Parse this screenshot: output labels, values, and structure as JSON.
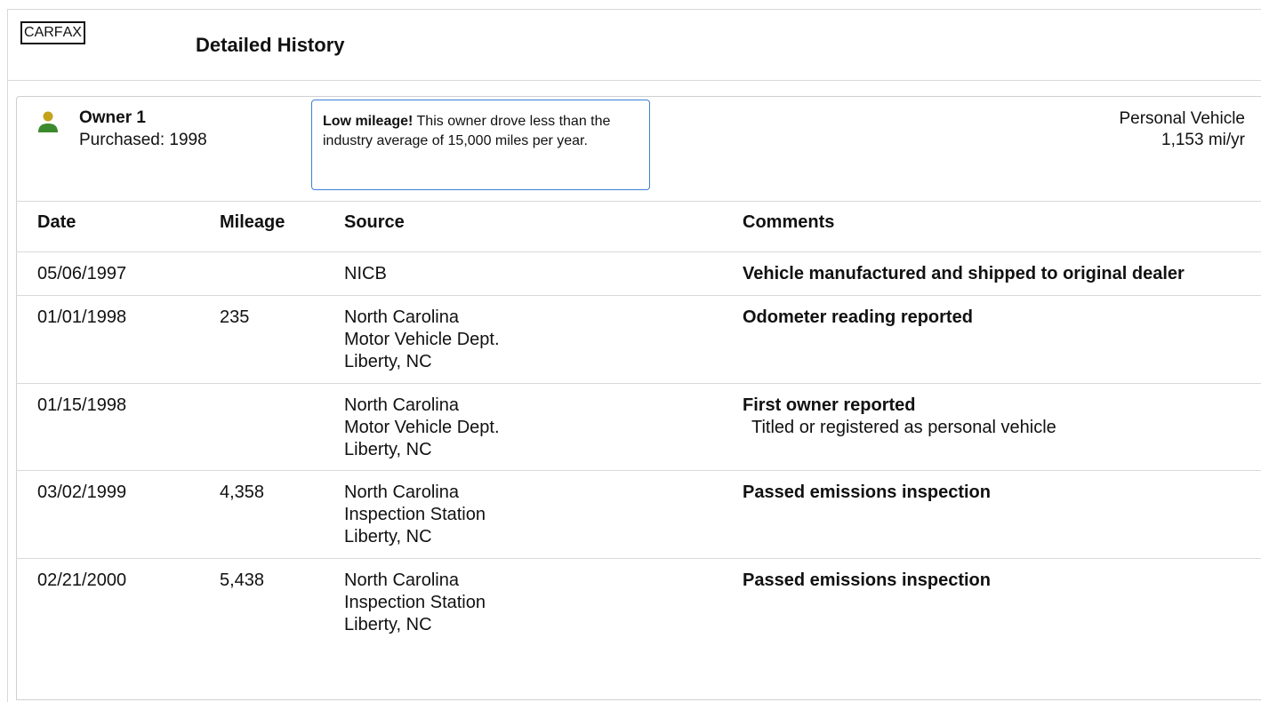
{
  "header": {
    "logo_letters": [
      "C",
      "A",
      "R",
      "F",
      "A",
      "X"
    ],
    "title": "Detailed History"
  },
  "owner": {
    "title": "Owner 1",
    "purchased": "Purchased: 1998",
    "icon": "person-icon",
    "icon_color_head": "#c4a21a",
    "icon_color_body": "#3c8a2e",
    "tip_bold": "Low mileage!",
    "tip_text": " This owner drove less than the industry average of 15,000 miles per year.",
    "tip_border_color": "#3b7fd4",
    "vehicle_type": "Personal Vehicle",
    "mileage_rate": "1,153 mi/yr"
  },
  "table": {
    "headers": [
      "Date",
      "Mileage",
      "Source",
      "Comments"
    ],
    "rows": [
      {
        "date": "05/06/1997",
        "mileage": "",
        "source": [
          "NICB"
        ],
        "comment": "Vehicle manufactured and shipped to original dealer",
        "detail": ""
      },
      {
        "date": "01/01/1998",
        "mileage": "235",
        "source": [
          "North Carolina",
          "Motor Vehicle Dept.",
          "Liberty, NC"
        ],
        "comment": "Odometer reading reported",
        "detail": ""
      },
      {
        "date": "01/15/1998",
        "mileage": "",
        "source": [
          "North Carolina",
          "Motor Vehicle Dept.",
          "Liberty, NC"
        ],
        "comment": "First owner reported",
        "detail": "Titled or registered as personal vehicle"
      },
      {
        "date": "03/02/1999",
        "mileage": "4,358",
        "source": [
          "North Carolina",
          "Inspection Station",
          "Liberty, NC"
        ],
        "comment": "Passed emissions inspection",
        "detail": ""
      },
      {
        "date": "02/21/2000",
        "mileage": "5,438",
        "source": [
          "North Carolina",
          "Inspection Station",
          "Liberty, NC"
        ],
        "comment": "Passed emissions inspection",
        "detail": ""
      }
    ]
  }
}
